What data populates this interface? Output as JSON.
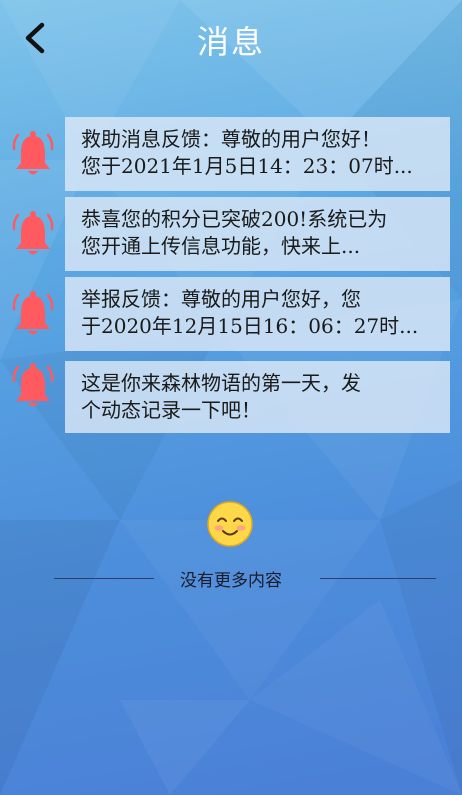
{
  "header": {
    "title": "消息"
  },
  "icons": {
    "back": "chevron-left-icon",
    "notice": "bell-icon",
    "empty": "smiley-icon"
  },
  "colors": {
    "bell": "#ff5a5f",
    "smiley_face": "#ffd84a"
  },
  "messages": [
    {
      "lines": [
        "救助消息反馈：尊敬的用户您好！",
        "您于2021年1月5日14：23：07时..."
      ]
    },
    {
      "lines": [
        "恭喜您的积分已突破200!系统已为",
        "您开通上传信息功能，快来上..."
      ]
    },
    {
      "lines": [
        "举报反馈：尊敬的用户您好，您",
        "于2020年12月15日16：06：27时..."
      ]
    },
    {
      "lines": [
        "这是你来森林物语的第一天，发",
        "个动态记录一下吧！"
      ]
    }
  ],
  "footer": {
    "no_more_text": "没有更多内容"
  }
}
